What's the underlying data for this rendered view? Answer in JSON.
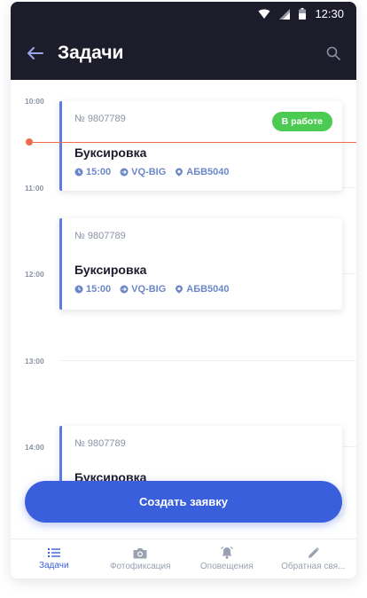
{
  "status": {
    "time": "12:30"
  },
  "header": {
    "title": "Задачи"
  },
  "timeline": {
    "hours": [
      "10:00",
      "11:00",
      "12:00",
      "13:00",
      "14:00"
    ],
    "tasks": [
      {
        "number": "№ 9807789",
        "name": "Буксировка",
        "time": "15:00",
        "vehicle": "VQ-BIG",
        "plate": "АБВ5040",
        "status": "В работе"
      },
      {
        "number": "№ 9807789",
        "name": "Буксировка",
        "time": "15:00",
        "vehicle": "VQ-BIG",
        "plate": "АБВ5040"
      },
      {
        "number": "№ 9807789",
        "name": "Буксировка"
      }
    ]
  },
  "cta": {
    "label": "Создать заявку"
  },
  "tabs": [
    {
      "label": "Задачи",
      "icon": "list-icon"
    },
    {
      "label": "Фотофиксация",
      "icon": "camera-icon"
    },
    {
      "label": "Оповещения",
      "icon": "bell-icon"
    },
    {
      "label": "Обратная свя...",
      "icon": "pencil-icon"
    }
  ],
  "colors": {
    "header": "#1c1c2b",
    "accent": "#3a5fdc",
    "status_green": "#4ccb53",
    "now_line": "#f06a4c"
  }
}
